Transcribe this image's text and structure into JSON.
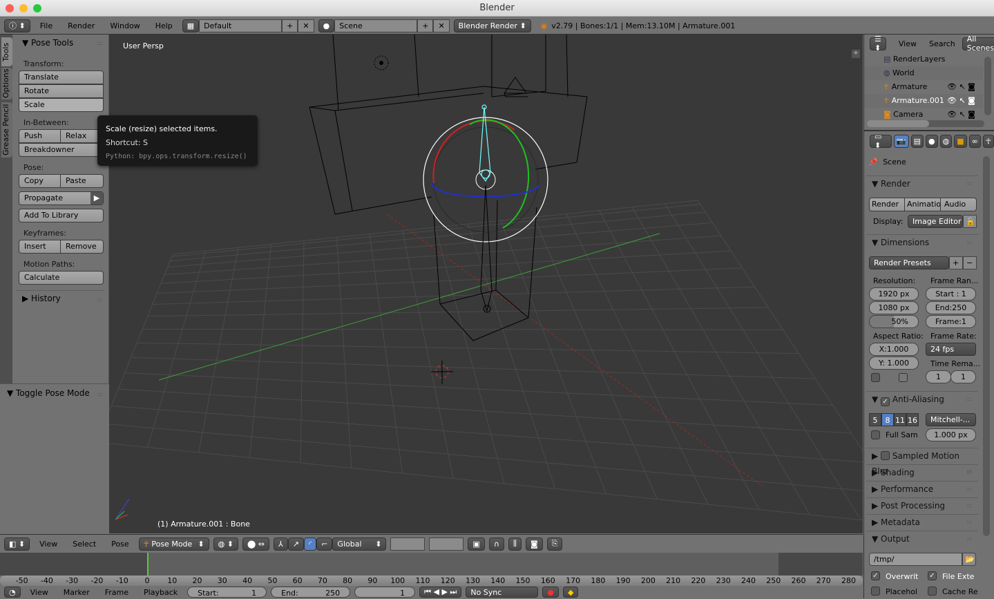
{
  "window": {
    "title": "Blender"
  },
  "info_header": {
    "menus": [
      "File",
      "Render",
      "Window",
      "Help"
    ],
    "screen_layout": "Default",
    "scene": "Scene",
    "engine": "Blender Render",
    "stats": "v2.79 | Bones:1/1  | Mem:13.10M | Armature.001"
  },
  "tool_tabs": [
    "Tools",
    "Options",
    "Grease Pencil"
  ],
  "tool_panel": {
    "title": "Pose Tools",
    "transform_label": "Transform:",
    "translate": "Translate",
    "rotate": "Rotate",
    "scale": "Scale",
    "inbetween_label": "In-Between:",
    "push": "Push",
    "relax": "Relax",
    "breakdowner": "Breakdowner",
    "pose_label": "Pose:",
    "copy": "Copy",
    "paste": "Paste",
    "propagate": "Propagate",
    "add_to_library": "Add To Library",
    "keyframes_label": "Keyframes:",
    "insert": "Insert",
    "remove": "Remove",
    "motion_paths_label": "Motion Paths:",
    "calculate": "Calculate",
    "history": "History",
    "operator_panel": "Toggle Pose Mode"
  },
  "tooltip": {
    "description": "Scale (resize) selected items.",
    "shortcut": "Shortcut: S",
    "python": "Python: bpy.ops.transform.resize()"
  },
  "viewport": {
    "view_name": "User Persp",
    "object_info": "(1) Armature.001 : Bone"
  },
  "view3d_header": {
    "menus": [
      "View",
      "Select",
      "Pose"
    ],
    "mode": "Pose Mode",
    "orientation": "Global"
  },
  "timeline": {
    "current_frame": 1,
    "ruler": [
      -50,
      -40,
      -30,
      -20,
      -10,
      0,
      10,
      20,
      30,
      40,
      50,
      60,
      70,
      80,
      90,
      100,
      110,
      120,
      130,
      140,
      150,
      160,
      170,
      180,
      190,
      200,
      210,
      220,
      230,
      240,
      250,
      260,
      270,
      280
    ],
    "menus": [
      "View",
      "Marker",
      "Frame",
      "Playback"
    ],
    "start": "Start:",
    "start_value": "1",
    "end": "End:",
    "end_value": "250",
    "frame_value": "1",
    "sync": "No Sync"
  },
  "outliner": {
    "menus": [
      "View",
      "Search"
    ],
    "filter": "All Scenes",
    "items": [
      "RenderLayers",
      "World",
      "Armature",
      "Armature.001",
      "Camera"
    ]
  },
  "properties": {
    "context": "Scene",
    "render": {
      "title": "Render",
      "render_btn": "Render",
      "anim_btn": "Animation",
      "audio_btn": "Audio",
      "display_label": "Display:",
      "display_value": "Image Editor"
    },
    "dimensions": {
      "title": "Dimensions",
      "presets": "Render Presets",
      "resolution_label": "Resolution:",
      "res_x": "1920 px",
      "res_y": "1080 px",
      "res_pct": "50%",
      "res_pct_value": 50,
      "frame_range_label": "Frame Ran...",
      "start": "Start : 1",
      "end": "End:250",
      "frame": "Frame:1",
      "aspect_label": "Aspect Ratio:",
      "aspect_x": "X:1.000",
      "aspect_y": "Y: 1.000",
      "frame_rate_label": "Frame Rate:",
      "fps": "24 fps",
      "time_remap_label": "Time Rema...",
      "remap_old": "1",
      "remap_new": "1"
    },
    "antialiasing": {
      "title": "Anti-Aliasing",
      "enabled": true,
      "samples": [
        "5",
        "8",
        "11",
        "16"
      ],
      "selected": "8",
      "filter": "Mitchell-...",
      "full_sample": "Full Sam",
      "filter_size": "1.000 px"
    },
    "collapsed": [
      "Sampled Motion Blur",
      "Shading",
      "Performance",
      "Post Processing",
      "Metadata"
    ],
    "output": {
      "title": "Output",
      "path": "/tmp/",
      "overwrite": "Overwrit",
      "file_ext": "File Exte",
      "placeholders": "Placehol",
      "cache": "Cache Re"
    }
  },
  "colors": {
    "viewport_bg": "#393939",
    "panel_bg": "#727272",
    "accent": "#5680c2",
    "x_axis": "#c83030",
    "y_axis": "#3ea13e",
    "bone": "#7ff"
  }
}
